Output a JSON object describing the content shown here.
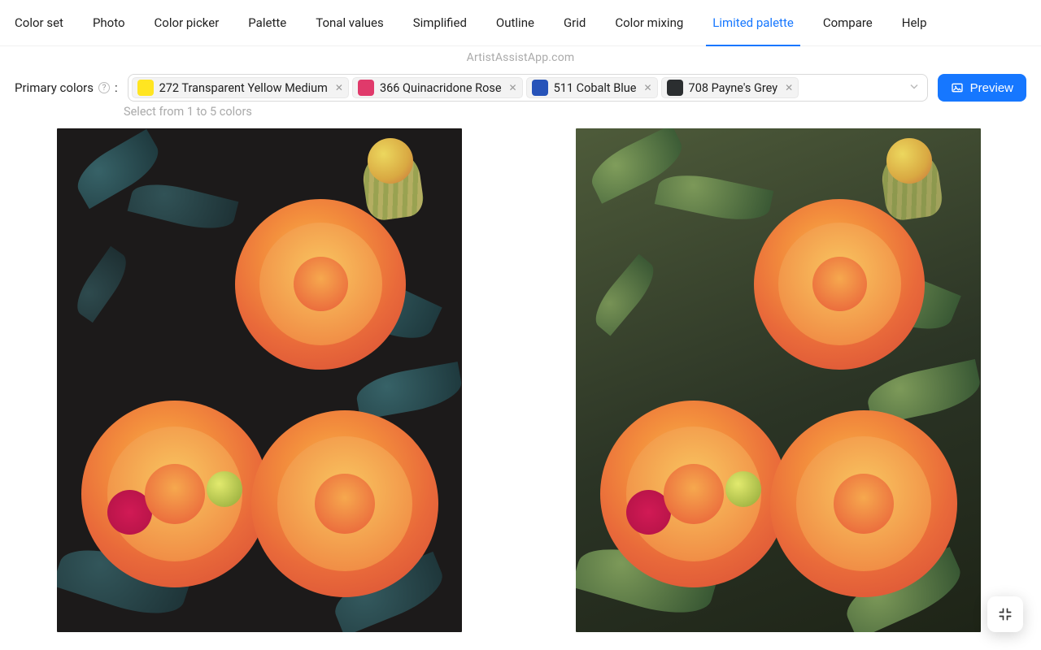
{
  "branding": "ArtistAssistApp.com",
  "tabs": [
    {
      "label": "Color set",
      "active": false
    },
    {
      "label": "Photo",
      "active": false
    },
    {
      "label": "Color picker",
      "active": false
    },
    {
      "label": "Palette",
      "active": false
    },
    {
      "label": "Tonal values",
      "active": false
    },
    {
      "label": "Simplified",
      "active": false
    },
    {
      "label": "Outline",
      "active": false
    },
    {
      "label": "Grid",
      "active": false
    },
    {
      "label": "Color mixing",
      "active": false
    },
    {
      "label": "Limited palette",
      "active": true
    },
    {
      "label": "Compare",
      "active": false
    },
    {
      "label": "Help",
      "active": false
    }
  ],
  "controls": {
    "label": "Primary colors",
    "label_suffix": ":",
    "hint": "Select from 1 to 5 colors",
    "preview_label": "Preview",
    "tags": [
      {
        "swatch": "#ffe521",
        "label": "272 Transparent Yellow Medium"
      },
      {
        "swatch": "#e03a6b",
        "label": "366 Quinacridone Rose"
      },
      {
        "swatch": "#2753b9",
        "label": "511 Cobalt Blue"
      },
      {
        "swatch": "#2b2e30",
        "label": "708 Payne's Grey"
      }
    ]
  }
}
